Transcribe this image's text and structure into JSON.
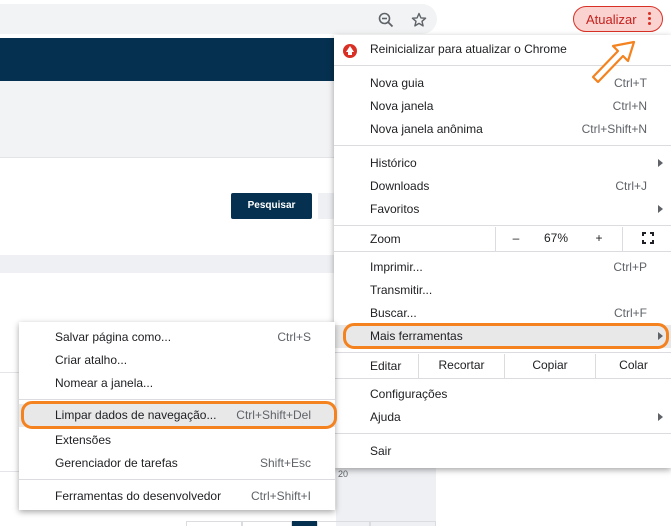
{
  "toolbar": {
    "zoom_icon": "zoom-out-icon",
    "star_icon": "star-icon",
    "update_label": "Atualizar",
    "menu_icon": "kebab-menu-icon",
    "update_color": "#d93025"
  },
  "page": {
    "search_button": "Pesquisar",
    "fragment_text": "20",
    "navbar_color": "#05304f"
  },
  "main_menu": {
    "restart": "Reinicializar para atualizar o Chrome",
    "new_tab": {
      "label": "Nova guia",
      "shortcut": "Ctrl+T"
    },
    "new_window": {
      "label": "Nova janela",
      "shortcut": "Ctrl+N"
    },
    "incognito": {
      "label": "Nova janela anônima",
      "shortcut": "Ctrl+Shift+N"
    },
    "history": {
      "label": "Histórico"
    },
    "downloads": {
      "label": "Downloads",
      "shortcut": "Ctrl+J"
    },
    "bookmarks": {
      "label": "Favoritos"
    },
    "zoom": {
      "label": "Zoom",
      "minus": "–",
      "value": "67%",
      "plus": "+"
    },
    "print": {
      "label": "Imprimir...",
      "shortcut": "Ctrl+P"
    },
    "cast": {
      "label": "Transmitir..."
    },
    "find": {
      "label": "Buscar...",
      "shortcut": "Ctrl+F"
    },
    "more_tools": {
      "label": "Mais ferramentas"
    },
    "edit": {
      "label": "Editar",
      "cut": "Recortar",
      "copy": "Copiar",
      "paste": "Colar"
    },
    "settings": {
      "label": "Configurações"
    },
    "help": {
      "label": "Ajuda"
    },
    "exit": {
      "label": "Sair"
    }
  },
  "sub_menu": {
    "save_page": {
      "label": "Salvar página como...",
      "shortcut": "Ctrl+S"
    },
    "create_shortcut": {
      "label": "Criar atalho..."
    },
    "name_window": {
      "label": "Nomear a janela..."
    },
    "clear_data": {
      "label": "Limpar dados de navegação...",
      "shortcut": "Ctrl+Shift+Del"
    },
    "extensions": {
      "label": "Extensões"
    },
    "task_manager": {
      "label": "Gerenciador de tarefas",
      "shortcut": "Shift+Esc"
    },
    "dev_tools": {
      "label": "Ferramentas do desenvolvedor",
      "shortcut": "Ctrl+Shift+I"
    }
  },
  "annotation_color": "#f4821f"
}
